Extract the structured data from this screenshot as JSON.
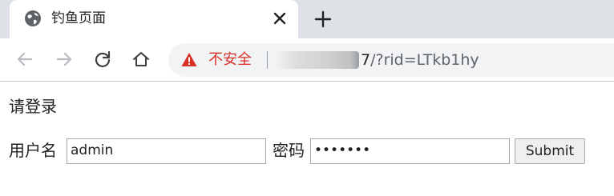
{
  "browser": {
    "tab": {
      "title": "钓鱼页面",
      "favicon": "globe-icon",
      "close_icon": "close-icon"
    },
    "new_tab_icon": "plus-icon",
    "nav": {
      "back_icon": "arrow-left-icon",
      "forward_icon": "arrow-right-icon",
      "reload_icon": "reload-icon",
      "home_icon": "home-icon"
    },
    "address_bar": {
      "security_icon": "warning-triangle-icon",
      "security_label": "不安全",
      "url_visible_host_end": "7",
      "url_path": "/?rid=LTkb1hy"
    }
  },
  "page": {
    "heading": "请登录",
    "username_label": "用户名",
    "username_value": "admin",
    "password_label": "密码",
    "password_value": "•••••••",
    "submit_label": "Submit"
  },
  "colors": {
    "warning_red": "#d93025",
    "tabstrip": "#dee1e6",
    "omnibox": "#f1f3f4"
  }
}
